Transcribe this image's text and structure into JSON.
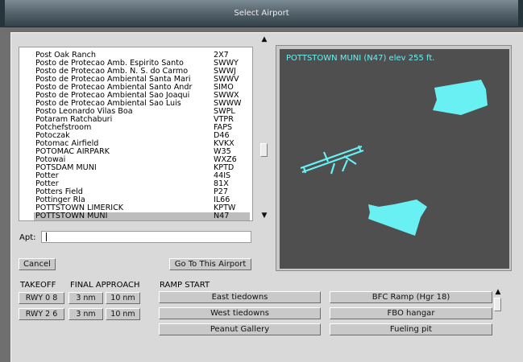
{
  "window": {
    "title": "Select Airport"
  },
  "airport_list": {
    "items": [
      {
        "name": "Post Oak Ranch",
        "code": "2X7"
      },
      {
        "name": "Posto de Protecao Amb. Espirito Santo",
        "code": "SWWY"
      },
      {
        "name": "Posto de Protecao Amb. N. S. do Carmo",
        "code": "SWWJ"
      },
      {
        "name": "Posto de Protecao Ambiental Santa Mari",
        "code": "SWWV"
      },
      {
        "name": "Posto de Protecao Ambiental Santo Andr",
        "code": "SIMO"
      },
      {
        "name": "Posto de Protecao Ambiental Sao Joaqui",
        "code": "SWWX"
      },
      {
        "name": "Posto de Protecao Ambiental Sao Luis",
        "code": "SWWW"
      },
      {
        "name": "Posto Leonardo Vilas Boa",
        "code": "SWPL"
      },
      {
        "name": "Potaram Ratchaburi",
        "code": "VTPR"
      },
      {
        "name": "Potchefstroom",
        "code": "FAPS"
      },
      {
        "name": "Potoczak",
        "code": "D46"
      },
      {
        "name": "Potomac Airfield",
        "code": "KVKX"
      },
      {
        "name": "POTOMAC AIRPARK",
        "code": "W35"
      },
      {
        "name": "Potowai",
        "code": "WXZ6"
      },
      {
        "name": "POTSDAM MUNI",
        "code": "KPTD"
      },
      {
        "name": "Potter",
        "code": "44IS"
      },
      {
        "name": "Potter",
        "code": "81X"
      },
      {
        "name": "Potters Field",
        "code": "P27"
      },
      {
        "name": "Pottinger Rla",
        "code": "IL66"
      },
      {
        "name": "POTTSTOWN LIMERICK",
        "code": "KPTW"
      },
      {
        "name": "POTTSTOWN MUNI",
        "code": "N47"
      }
    ],
    "selected_index": 20
  },
  "apt_field": {
    "label": "Apt:",
    "value": ""
  },
  "buttons": {
    "cancel": "Cancel",
    "go_to_airport": "Go To This Airport"
  },
  "preview": {
    "title": "POTTSTOWN MUNI (N47) elev 255 ft."
  },
  "takeoff": {
    "label": "TAKEOFF",
    "runways": [
      {
        "label": "RWY 0 8"
      },
      {
        "label": "RWY 2 6"
      }
    ]
  },
  "final_approach": {
    "label": "FINAL APPROACH",
    "rows": [
      {
        "a": "3 nm",
        "b": "10 nm"
      },
      {
        "a": "3 nm",
        "b": "10 nm"
      }
    ]
  },
  "ramp_start": {
    "label": "RAMP START",
    "items": [
      "East tiedowns",
      "BFC Ramp (Hgr 18)",
      "West tiedowns",
      "FBO hangar",
      "Peanut Gallery",
      "Fueling pit"
    ]
  },
  "colors": {
    "map_background": "#4f4f4f",
    "map_features": "#68f0f3",
    "dialog_background": "#d9d9d9"
  }
}
